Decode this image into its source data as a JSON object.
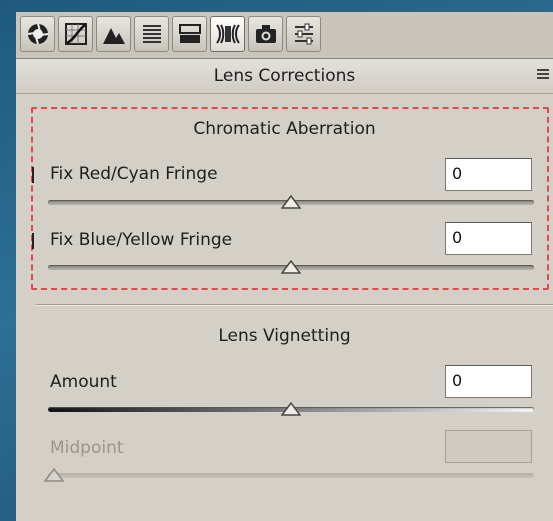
{
  "tabs": [
    {
      "name": "basic-tab",
      "icon": "aperture-icon",
      "active": false
    },
    {
      "name": "tone-curve-tab",
      "icon": "tone-curve-icon",
      "active": false
    },
    {
      "name": "detail-tab",
      "icon": "detail-mountains-icon",
      "active": false
    },
    {
      "name": "hsl-tab",
      "icon": "hsl-lines-icon",
      "active": false
    },
    {
      "name": "split-toning-tab",
      "icon": "split-toning-icon",
      "active": false
    },
    {
      "name": "lens-corrections-tab",
      "icon": "lens-icon",
      "active": true
    },
    {
      "name": "camera-calibration-tab",
      "icon": "camera-icon",
      "active": false
    },
    {
      "name": "presets-tab",
      "icon": "sliders-icon",
      "active": false
    }
  ],
  "panel": {
    "title": "Lens Corrections",
    "menu_icon": "panel-menu-icon"
  },
  "chromatic": {
    "title": "Chromatic Aberration",
    "red_cyan": {
      "label": "Fix Red/Cyan Fringe",
      "value": "0",
      "slider_fraction": 0.5
    },
    "blue_yellow": {
      "label": "Fix Blue/Yellow Fringe",
      "value": "0",
      "slider_fraction": 0.5
    }
  },
  "vignetting": {
    "title": "Lens Vignetting",
    "amount": {
      "label": "Amount",
      "value": "0",
      "slider_fraction": 0.5
    },
    "midpoint": {
      "label": "Midpoint",
      "value": "",
      "slider_fraction": 0.0,
      "disabled": true
    }
  },
  "colors": {
    "panel_bg": "#d4d0c8",
    "selection_dash": "#e04a4a",
    "background": "#2f6f96"
  }
}
